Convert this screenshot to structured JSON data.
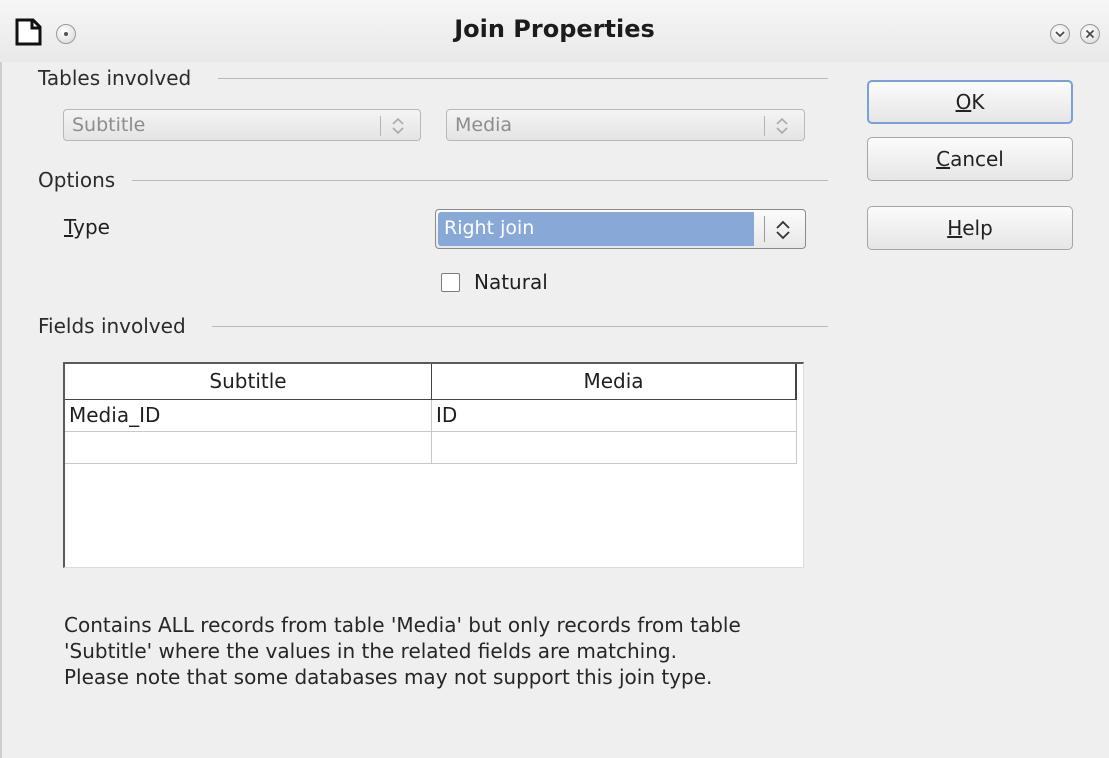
{
  "window": {
    "title": "Join Properties"
  },
  "tables_involved": {
    "label": "Tables involved",
    "left_table": "Subtitle",
    "right_table": "Media"
  },
  "options": {
    "label": "Options",
    "type_label": "Type",
    "type_mnemonic": "T",
    "type_rest": "ype",
    "type_value": "Right join",
    "natural_label": "Natural",
    "natural_checked": false
  },
  "fields_involved": {
    "label": "Fields involved",
    "columns": [
      "Subtitle",
      "Media"
    ],
    "rows": [
      [
        "Media_ID",
        "ID"
      ],
      [
        "",
        ""
      ]
    ]
  },
  "description": [
    "Contains ALL records from table 'Media' but only records from table",
    "'Subtitle' where the values in the related fields are matching.",
    "Please note that some databases may not support this join type."
  ],
  "buttons": {
    "ok": {
      "mnemonic": "O",
      "rest": "K"
    },
    "cancel": {
      "mnemonic": "C",
      "rest": "ancel"
    },
    "help": {
      "mnemonic": "H",
      "rest": "elp"
    }
  },
  "icons": {
    "app": "document-icon",
    "menu": "window-menu-icon",
    "minimize": "chevron-down-icon",
    "close": "close-icon"
  },
  "colors": {
    "selection": "#88a9d8",
    "default_button_border": "#7aa1d6",
    "background": "#efefef"
  }
}
